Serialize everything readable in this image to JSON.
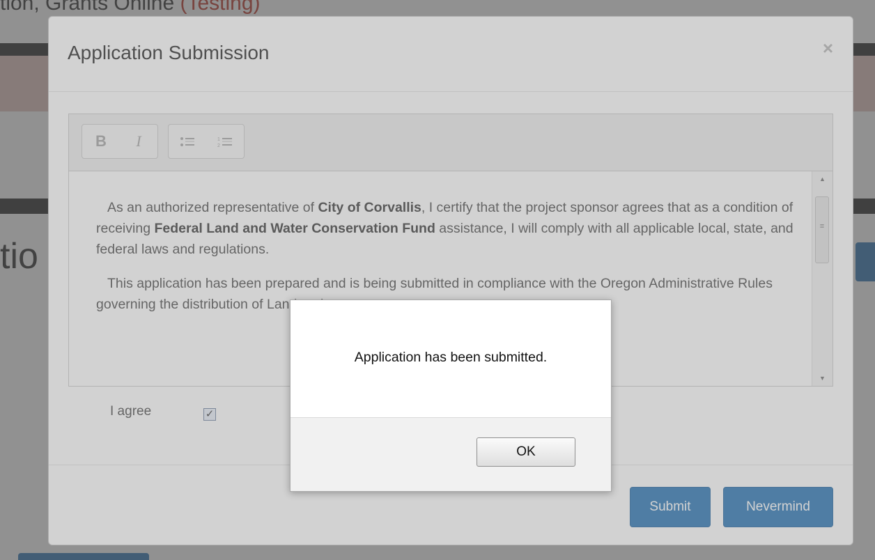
{
  "background": {
    "title_prefix": "tion, Grants Online ",
    "title_test": "(Testing)",
    "page_heading": "tio"
  },
  "modal": {
    "title": "Application Submission",
    "close_symbol": "×",
    "toolbar": {
      "bold_label": "B",
      "italic_label": "I"
    },
    "content": {
      "p1_a": "As an authorized representative of ",
      "p1_org": "City of Corvallis",
      "p1_b": ", I certify that the project sponsor agrees that as a condition of receiving ",
      "p1_fund": "Federal Land and Water Conservation Fund",
      "p1_c": " assistance, I will comply with all applicable local, state, and federal laws and regulations.",
      "p2": "This application has been prepared and is being submitted in compliance with the Oregon Administrative Rules governing the distribution of Land and"
    },
    "agree_label": "I agree",
    "agree_checked": true,
    "agree_mark": "✓",
    "submit_label": "Submit",
    "nevermind_label": "Nevermind"
  },
  "alert": {
    "message": "Application has been submitted.",
    "ok_label": "OK"
  },
  "colors": {
    "primary_button": "#337ab7",
    "background_dark_bar": "#2f2f2f",
    "testing_text": "#c0392b"
  }
}
